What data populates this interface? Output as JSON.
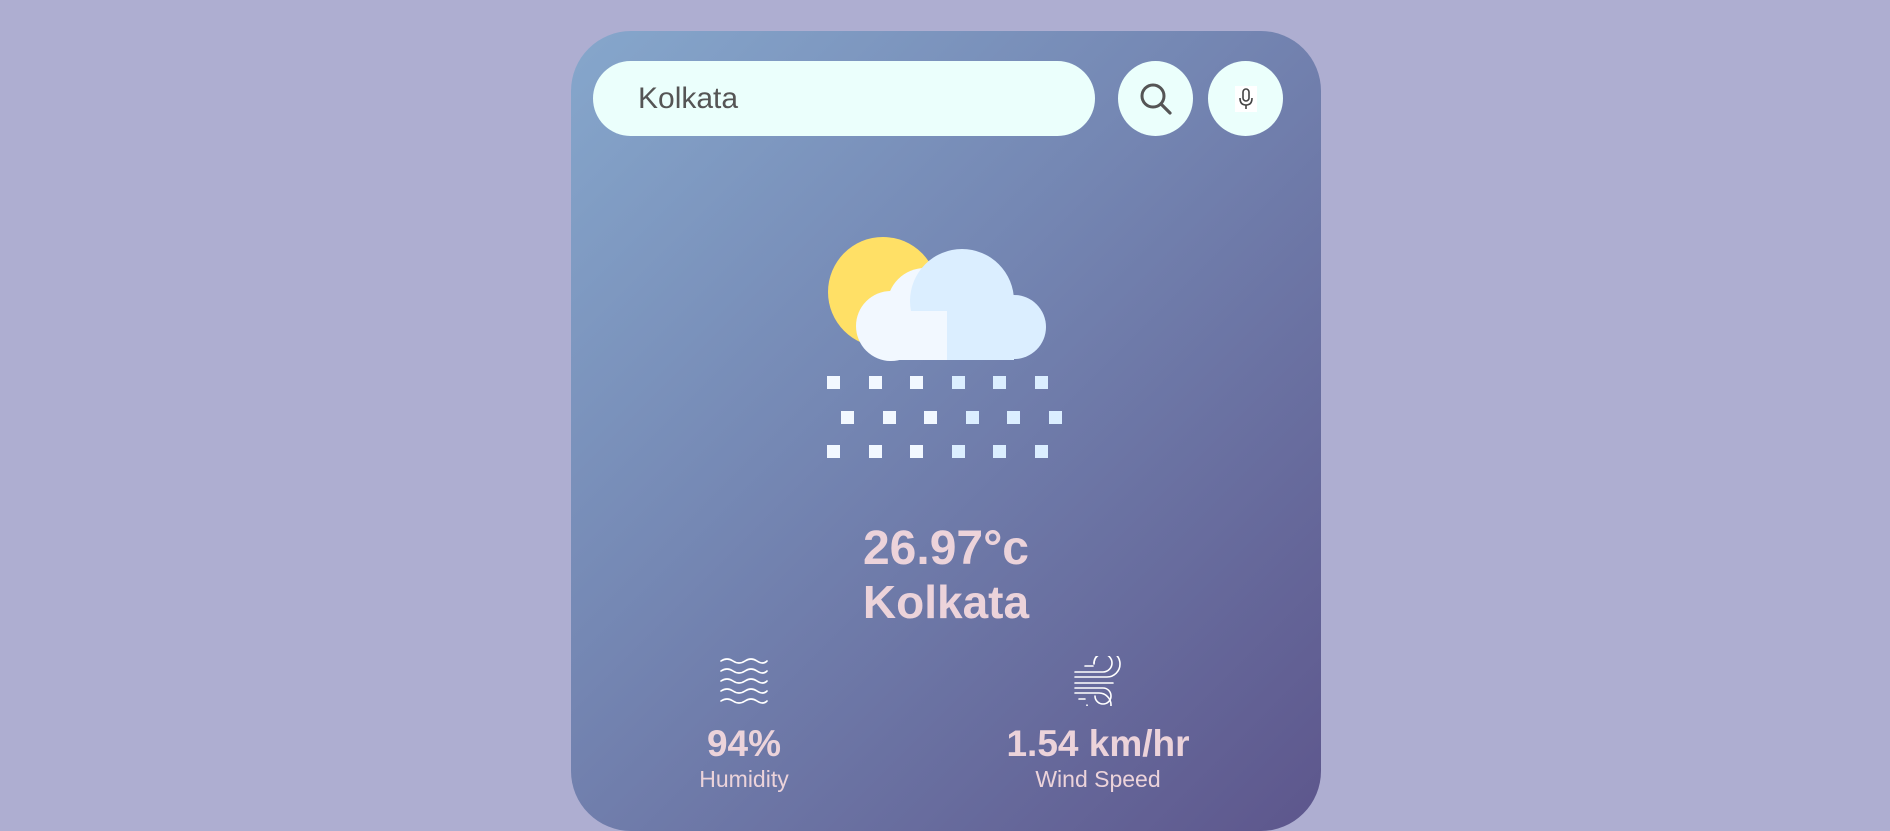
{
  "search": {
    "value": "Kolkata"
  },
  "icons": {
    "search": "search-icon",
    "mic": "microphone-icon",
    "weather": "sun-cloud-snow-icon",
    "humidity": "humidity-waves-icon",
    "wind": "wind-icon"
  },
  "weather": {
    "temperature": "26.97°c",
    "city": "Kolkata"
  },
  "details": {
    "humidity_value": "94%",
    "humidity_label": "Humidity",
    "wind_value": "1.54 km/hr",
    "wind_label": "Wind Speed"
  },
  "colors": {
    "page_background": "#aeaed1",
    "card_gradient_start": "#86a7cc",
    "card_gradient_end": "#5d568c",
    "input_background": "#ebfffc",
    "text_primary": "#ecd3da",
    "sun": "#ffe066",
    "cloud_light": "#f2f8ff",
    "cloud_shade": "#dbeeff"
  }
}
